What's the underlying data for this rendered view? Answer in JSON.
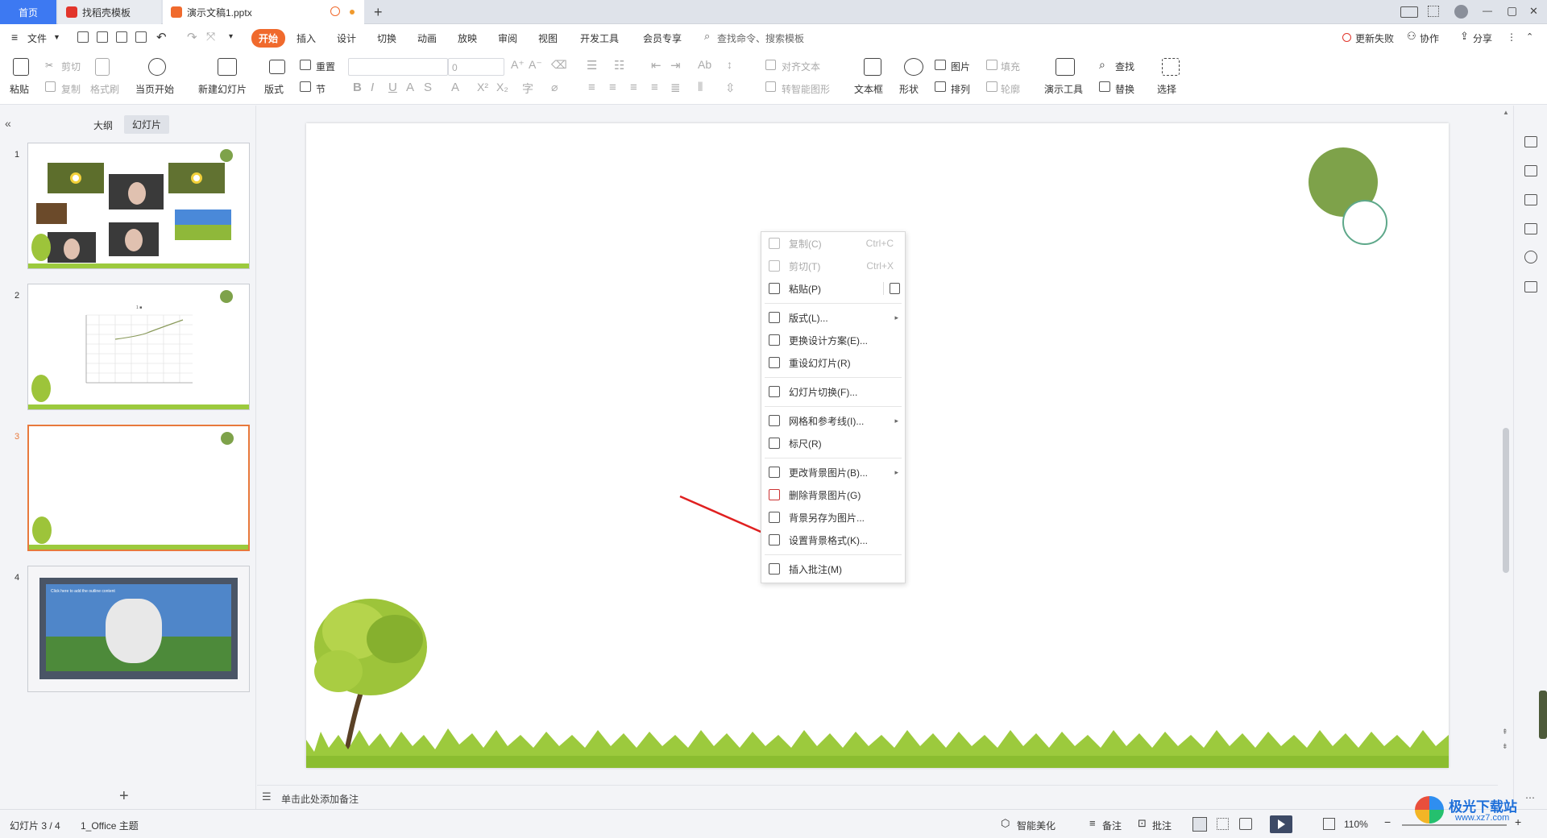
{
  "tabs": {
    "home": "首页",
    "template": "找稻壳模板",
    "doc": "演示文稿1.pptx",
    "new_tab": "+"
  },
  "window": {
    "restore": "▢",
    "min": "—",
    "close": "✕"
  },
  "menu": {
    "file": "文件",
    "items": [
      "开始",
      "插入",
      "设计",
      "切换",
      "动画",
      "放映",
      "审阅",
      "视图",
      "开发工具",
      "会员专享"
    ],
    "search": "查找命令、搜索模板",
    "update_fail": "更新失败",
    "collab": "协作",
    "share": "分享"
  },
  "ribbon": {
    "paste": "粘贴",
    "cut": "剪切",
    "copy": "复制",
    "format_painter": "格式刷",
    "from_current": "当页开始",
    "new_slide": "新建幻灯片",
    "layout": "版式",
    "section": "节",
    "reset": "重置",
    "font_size": "0",
    "align_text": "对齐文本",
    "smart_shape": "转智能图形",
    "textbox": "文本框",
    "shape": "形状",
    "picture": "图片",
    "arrange": "排列",
    "fill": "填充",
    "outline": "轮廓",
    "present_tool": "演示工具",
    "find": "查找",
    "replace": "替换",
    "select": "选择"
  },
  "panel": {
    "outline_tab": "大纲",
    "slides_tab": "幻灯片",
    "slide_numbers": [
      "1",
      "2",
      "3",
      "4"
    ],
    "add": "+",
    "slide4_text": "Click here to add the outline content",
    "slide2_title": "1 ■"
  },
  "context_menu": {
    "items": [
      {
        "label": "复制(C)",
        "shortcut": "Ctrl+C"
      },
      {
        "label": "剪切(T)",
        "shortcut": "Ctrl+X"
      },
      {
        "label": "粘贴(P)"
      },
      {
        "label": "版式(L)..."
      },
      {
        "label": "更换设计方案(E)..."
      },
      {
        "label": "重设幻灯片(R)"
      },
      {
        "label": "幻灯片切换(F)..."
      },
      {
        "label": "网格和参考线(I)..."
      },
      {
        "label": "标尺(R)"
      },
      {
        "label": "更改背景图片(B)..."
      },
      {
        "label": "删除背景图片(G)"
      },
      {
        "label": "背景另存为图片..."
      },
      {
        "label": "设置背景格式(K)..."
      },
      {
        "label": "插入批注(M)"
      }
    ]
  },
  "notes": {
    "placeholder": "单击此处添加备注"
  },
  "status": {
    "slide_count": "幻灯片 3 / 4",
    "theme": "1_Office 主题",
    "beautify": "智能美化",
    "notes": "备注",
    "comments": "批注",
    "zoom": "110%"
  },
  "watermark": {
    "site": "极光下载站",
    "url": "www.xz7.com"
  },
  "colors": {
    "accent": "#3d79f2",
    "start_tab": "#f06a2d",
    "selected_slide": "#e8793c",
    "circle_fill": "#7ea24a",
    "circle_ring": "#5ea88a",
    "arrow": "#e02020"
  }
}
